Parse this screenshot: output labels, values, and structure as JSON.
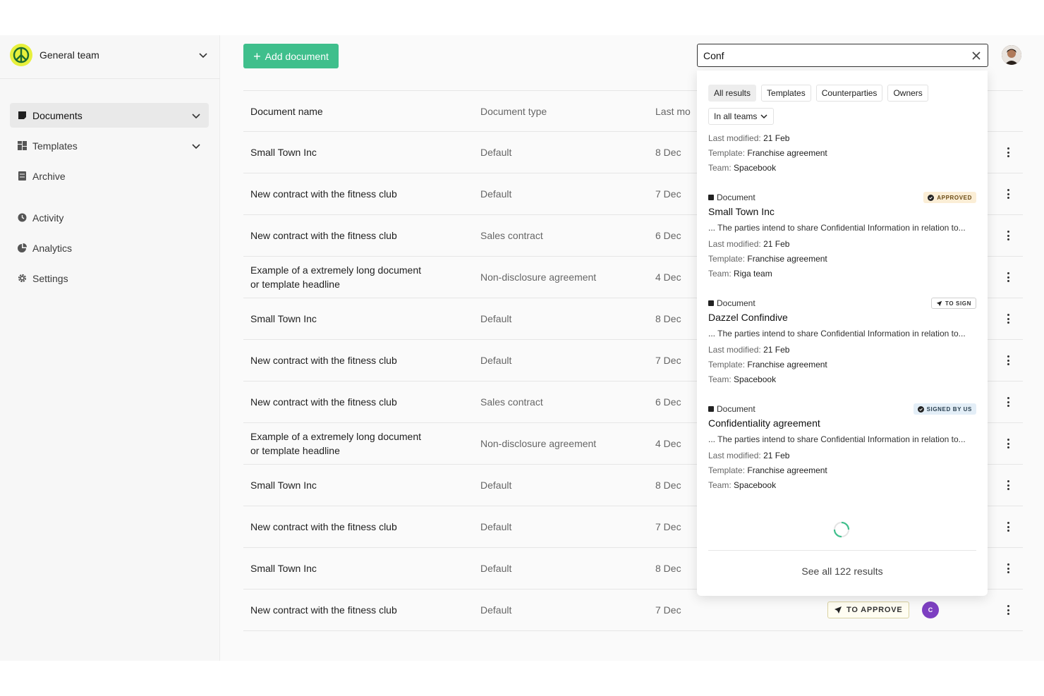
{
  "sidebar": {
    "team_name": "General team",
    "items": [
      {
        "label": "Documents",
        "icon": "document-icon"
      },
      {
        "label": "Templates",
        "icon": "templates-icon"
      },
      {
        "label": "Archive",
        "icon": "archive-icon"
      },
      {
        "label": "Activity",
        "icon": "clock-icon"
      },
      {
        "label": "Analytics",
        "icon": "pie-chart-icon"
      },
      {
        "label": "Settings",
        "icon": "gear-icon"
      }
    ]
  },
  "toolbar": {
    "add_label": "Add document",
    "accent": "#3fbf8c"
  },
  "search": {
    "value": "Conf"
  },
  "table": {
    "headers": {
      "name": "Document name",
      "type": "Document type",
      "date": "Last mo"
    },
    "rows": [
      {
        "name": "Small Town Inc",
        "type": "Default",
        "date": "8 Dec"
      },
      {
        "name": "New contract with the fitness club",
        "type": "Default",
        "date": "7 Dec"
      },
      {
        "name": "New contract with the fitness club",
        "type": "Sales contract",
        "date": "6 Dec"
      },
      {
        "name": "Example of a extremely long document or template headline",
        "type": "Non-disclosure agreement",
        "date": "4 Dec"
      },
      {
        "name": "Small Town Inc",
        "type": "Default",
        "date": "8 Dec"
      },
      {
        "name": "New contract with the fitness club",
        "type": "Default",
        "date": "7 Dec"
      },
      {
        "name": "New contract with the fitness club",
        "type": "Sales contract",
        "date": "6 Dec"
      },
      {
        "name": "Example of a extremely long document or template headline",
        "type": "Non-disclosure agreement",
        "date": "4 Dec"
      },
      {
        "name": "Small Town Inc",
        "type": "Default",
        "date": "8 Dec"
      },
      {
        "name": "New contract with the fitness club",
        "type": "Default",
        "date": "7 Dec"
      },
      {
        "name": "Small Town Inc",
        "type": "Default",
        "date": "8 Dec"
      },
      {
        "name": "New contract with the fitness club",
        "type": "Default",
        "date": "7 Dec",
        "status": "TO APPROVE",
        "owner_initial": "C"
      }
    ]
  },
  "dropdown": {
    "filters": [
      "All results",
      "Templates",
      "Counterparties",
      "Owners"
    ],
    "team_filter": "In all teams",
    "partial": {
      "modified_label": "Last modified:",
      "modified": "21 Feb",
      "template_label": "Template:",
      "template": "Franchise agreement",
      "team_label": "Team:",
      "team": "Spacebook"
    },
    "results": [
      {
        "kind": "Document",
        "badge": "APPROVED",
        "title": "Small Town Inc",
        "snippet": "... The parties intend to share Confidential Information in relation to...",
        "modified_label": "Last modified:",
        "modified": "21 Feb",
        "template_label": "Template:",
        "template": "Franchise agreement",
        "team_label": "Team:",
        "team": "Riga team"
      },
      {
        "kind": "Document",
        "badge": "TO SIGN",
        "title": "Dazzel Confindive",
        "snippet": "... The parties intend to share Confidential Information in relation to...",
        "modified_label": "Last modified:",
        "modified": "21 Feb",
        "template_label": "Template:",
        "template": "Franchise agreement",
        "team_label": "Team:",
        "team": "Spacebook"
      },
      {
        "kind": "Document",
        "badge": "SIGNED BY US",
        "title": "Confidentiality agreement",
        "snippet": "... The parties intend to share Confidential Information in relation to...",
        "modified_label": "Last modified:",
        "modified": "21 Feb",
        "template_label": "Template:",
        "template": "Franchise agreement",
        "team_label": "Team:",
        "team": "Spacebook"
      }
    ],
    "see_all": "See all 122 results"
  }
}
